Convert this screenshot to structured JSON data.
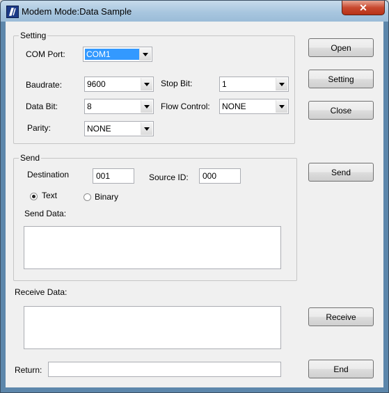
{
  "window": {
    "title": "Modem Mode:Data Sample",
    "close_glyph": "✕",
    "icon": "app-icon"
  },
  "setting": {
    "group_label": "Setting",
    "com_port_label": "COM Port:",
    "com_port_value": "COM1",
    "baudrate_label": "Baudrate:",
    "baudrate_value": "9600",
    "stop_bit_label": "Stop Bit:",
    "stop_bit_value": "1",
    "data_bit_label": "Data Bit:",
    "data_bit_value": "8",
    "flow_control_label": "Flow Control:",
    "flow_control_value": "NONE",
    "parity_label": "Parity:",
    "parity_value": "NONE"
  },
  "send": {
    "group_label": "Send",
    "destination_label": "Destination",
    "destination_value": "001",
    "source_id_label": "Source ID:",
    "source_id_value": "000",
    "text_radio_label": "Text",
    "binary_radio_label": "Binary",
    "selected_mode": "Text",
    "send_data_label": "Send Data:",
    "send_data_value": ""
  },
  "receive": {
    "label": "Receive Data:",
    "value": ""
  },
  "return": {
    "label": "Return:",
    "value": ""
  },
  "buttons": {
    "open": "Open",
    "setting": "Setting",
    "close": "Close",
    "send": "Send",
    "receive": "Receive",
    "end": "End"
  },
  "colors": {
    "title_bar": "#a8c6df",
    "selection": "#3399ff",
    "close_button": "#c8492f"
  }
}
